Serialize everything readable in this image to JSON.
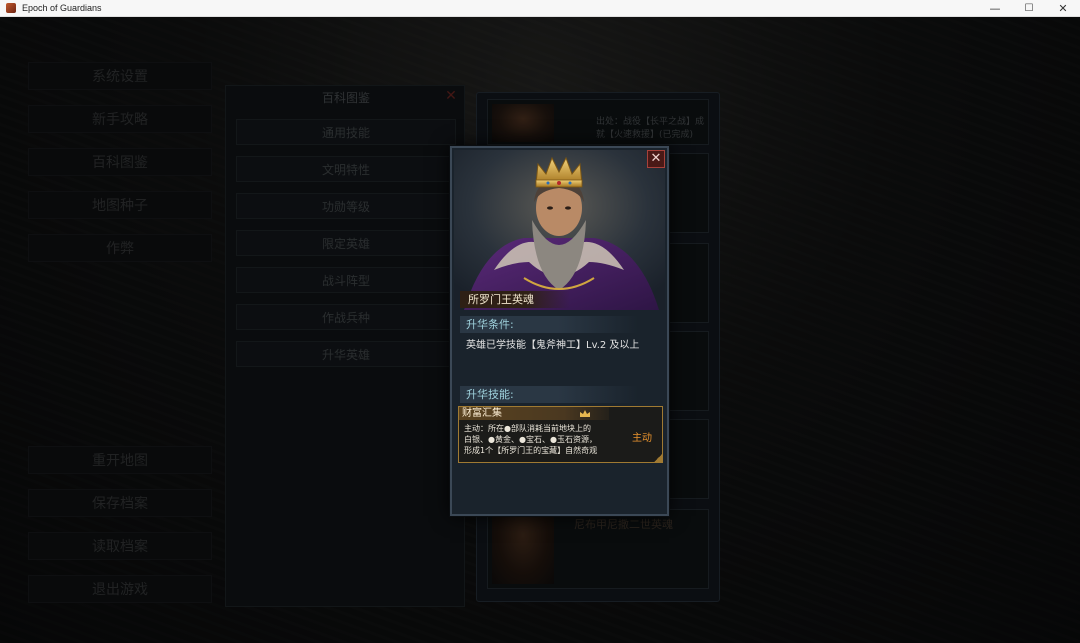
{
  "window": {
    "title": "Epoch of Guardians",
    "minimize": "—",
    "maximize": "☐",
    "close": "✕"
  },
  "main_menu": {
    "items": [
      "系统设置",
      "新手攻略",
      "百科图鉴",
      "地图种子",
      "作弊",
      "重开地图",
      "保存档案",
      "读取档案",
      "退出游戏"
    ]
  },
  "encyclopedia": {
    "title": "百科图鉴",
    "close": "✕",
    "categories": [
      "通用技能",
      "文明特性",
      "功勋等级",
      "限定英雄",
      "战斗阵型",
      "作战兵种",
      "升华英雄"
    ]
  },
  "hero_list": {
    "first_card_text": "出处：战役【长平之战】成就【火速救援】(已完成)",
    "last_card_name": "尼布甲尼撒二世英魂"
  },
  "modal": {
    "close": "✕",
    "hero_name": "所罗门王英魂",
    "condition_header": "升华条件:",
    "condition_text": "英雄已学技能【鬼斧神工】Lv.2 及以上",
    "skill_header": "升华技能:",
    "skill": {
      "name": "财富汇集",
      "desc_line1": "主动：所在●部队消耗当前地块上的",
      "desc_line2": "白银、●黄金、●宝石、●玉石资源，",
      "desc_line3": "形成1个【所罗门王的宝藏】自然奇观",
      "type": "主动"
    }
  }
}
